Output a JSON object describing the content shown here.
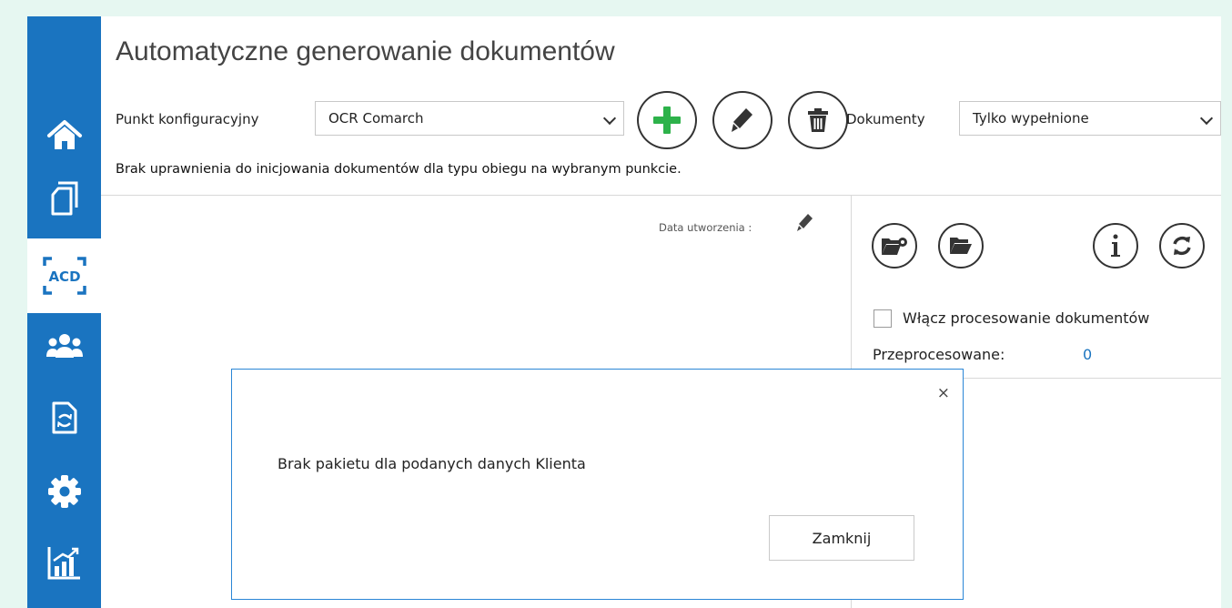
{
  "app": {
    "title": "Automatyczne generowanie dokumentów"
  },
  "sidebar": {
    "accent_color": "#1a74c0",
    "items": [
      {
        "icon": "home-icon",
        "active": false
      },
      {
        "icon": "documents-icon",
        "active": false
      },
      {
        "icon": "acd-scan-icon",
        "label": "ACD",
        "active": true
      },
      {
        "icon": "users-icon",
        "active": false
      },
      {
        "icon": "document-sync-icon",
        "active": false
      },
      {
        "icon": "gear-icon",
        "active": false
      },
      {
        "icon": "chart-icon",
        "active": false
      }
    ]
  },
  "toolbar": {
    "config_point_label": "Punkt konfiguracyjny",
    "config_point_value": "OCR Comarch",
    "documents_label": "Dokumenty",
    "documents_value": "Tylko wypełnione",
    "add_icon": "plus-icon",
    "edit_icon": "pencil-icon",
    "delete_icon": "trash-icon",
    "add_color": "#2db24a"
  },
  "warning": "Brak uprawnienia do inicjowania dokumentów dla typu obiegu na wybranym punkcie.",
  "list_panel": {
    "created_label": "Data utworzenia :"
  },
  "right_panel": {
    "enable_processing_label": "Włącz procesowanie dokumentów",
    "enable_processing_checked": false,
    "processed_label": "Przeprocesowane:",
    "processed_value": "0"
  },
  "dialog": {
    "message": "Brak pakietu dla podanych danych Klienta",
    "close_symbol": "×",
    "button_label": "Zamknij"
  }
}
